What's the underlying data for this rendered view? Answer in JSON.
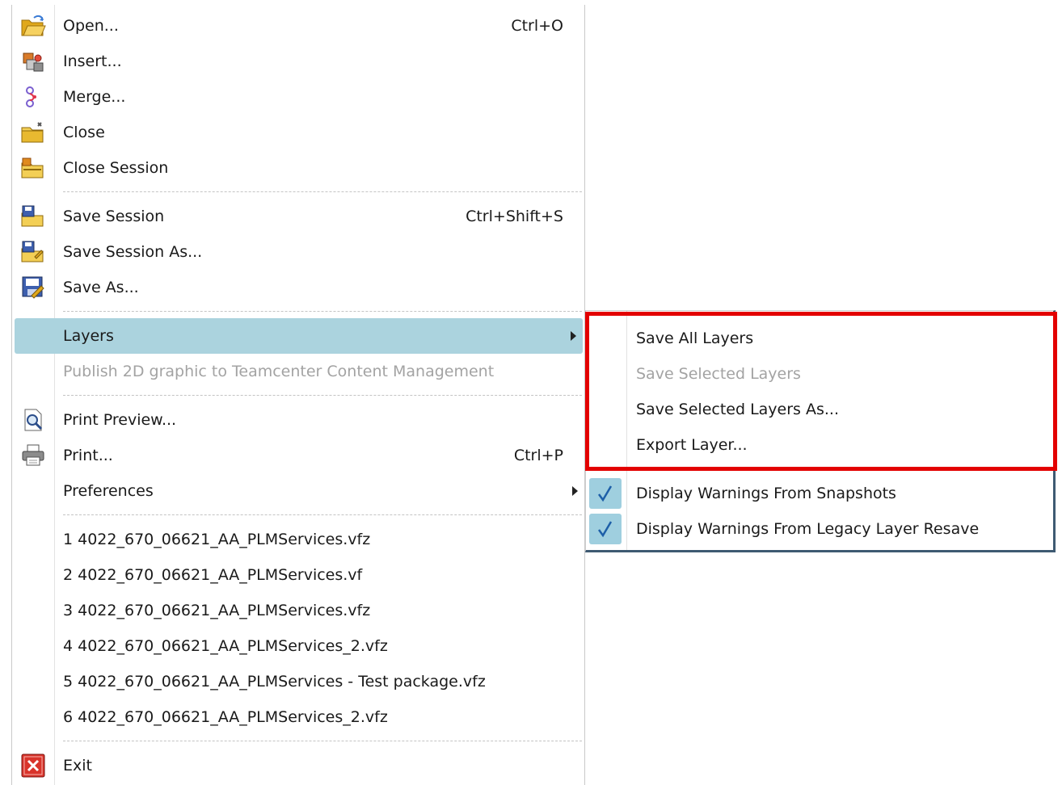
{
  "file_menu": {
    "items": [
      {
        "label": "Open...",
        "shortcut": "Ctrl+O",
        "icon": "open-folder-icon"
      },
      {
        "label": "Insert...",
        "shortcut": "",
        "icon": "insert-parts-icon"
      },
      {
        "label": "Merge...",
        "shortcut": "",
        "icon": "merge-icon"
      },
      {
        "label": "Close",
        "shortcut": "",
        "icon": "close-folder-icon"
      },
      {
        "label": "Close Session",
        "shortcut": "",
        "icon": "close-session-icon"
      },
      {
        "label": "Save Session",
        "shortcut": "Ctrl+Shift+S",
        "icon": "save-session-icon"
      },
      {
        "label": "Save Session As...",
        "shortcut": "",
        "icon": "save-session-as-icon"
      },
      {
        "label": "Save As...",
        "shortcut": "",
        "icon": "save-as-icon"
      },
      {
        "label": "Layers",
        "shortcut": "",
        "state": "highlighted"
      },
      {
        "label": "Publish 2D graphic to Teamcenter Content Management",
        "shortcut": "",
        "state": "disabled"
      },
      {
        "label": "Print Preview...",
        "shortcut": "",
        "icon": "print-preview-icon"
      },
      {
        "label": "Print...",
        "shortcut": "Ctrl+P",
        "icon": "printer-icon"
      },
      {
        "label": "Preferences",
        "shortcut": ""
      }
    ],
    "recent_files": [
      "1 4022_670_06621_AA_PLMServices.vfz",
      "2 4022_670_06621_AA_PLMServices.vf",
      "3 4022_670_06621_AA_PLMServices.vfz",
      "4 4022_670_06621_AA_PLMServices_2.vfz",
      "5 4022_670_06621_AA_PLMServices - Test package.vfz",
      "6 4022_670_06621_AA_PLMServices_2.vfz"
    ],
    "exit": {
      "label": "Exit",
      "icon": "exit-icon"
    }
  },
  "layers_submenu": {
    "items": [
      {
        "label": "Save All Layers",
        "state": "enabled"
      },
      {
        "label": "Save Selected Layers",
        "state": "disabled"
      },
      {
        "label": "Save Selected Layers As...",
        "state": "enabled"
      },
      {
        "label": "Export Layer...",
        "state": "enabled"
      }
    ],
    "toggles": [
      {
        "label": "Display Warnings From Snapshots",
        "checked": true
      },
      {
        "label": "Display Warnings From Legacy Layer Resave",
        "checked": true
      }
    ]
  },
  "colors": {
    "highlight": "#abd3de",
    "check_bg": "#9fcfdf",
    "annotation_box": "#e30000",
    "disabled_text": "#a3a3a3"
  }
}
